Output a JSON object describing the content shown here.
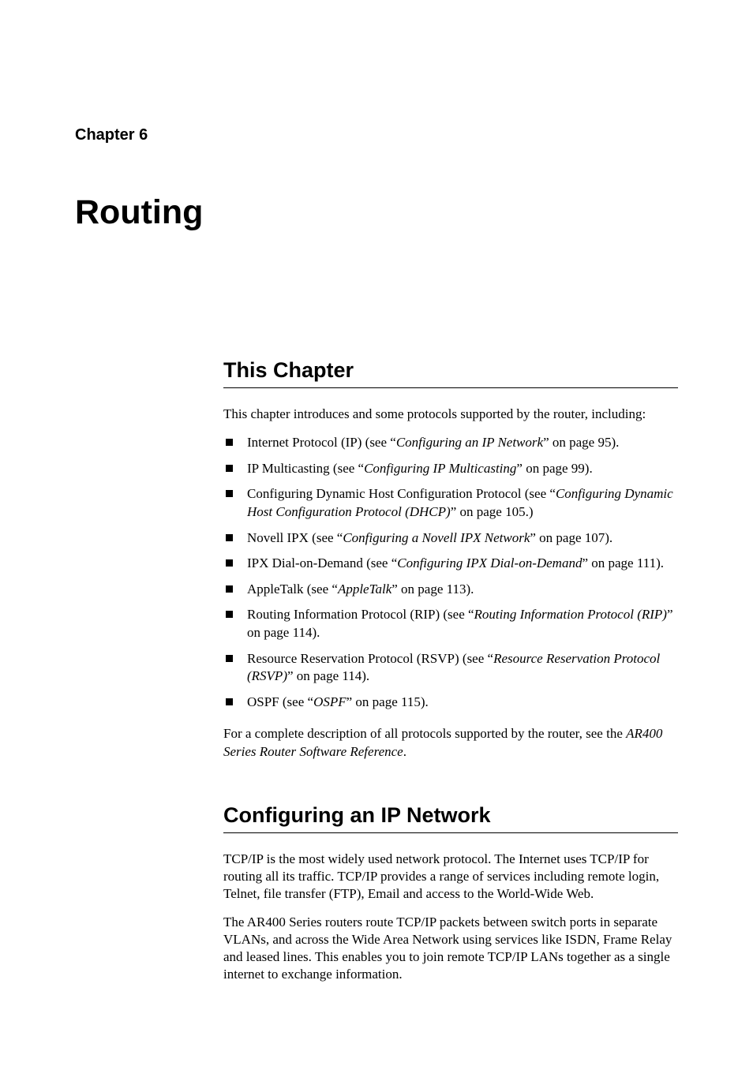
{
  "chapter_label": "Chapter 6",
  "chapter_title": "Routing",
  "section1": {
    "heading": "This Chapter",
    "intro": "This chapter introduces and some protocols supported by the router, including:",
    "items": [
      {
        "pre": "Internet Protocol (IP) (see “",
        "em": "Configuring an IP Network",
        "post": "” on page 95)."
      },
      {
        "pre": "IP Multicasting (see “",
        "em": "Configuring IP Multicasting",
        "post": "” on page 99)."
      },
      {
        "pre": "Configuring Dynamic Host Configuration Protocol (see “",
        "em": "Configuring Dynamic Host Configuration Protocol (DHCP)",
        "post": "” on page 105.)"
      },
      {
        "pre": "Novell IPX (see “",
        "em": "Configuring a Novell IPX Network",
        "post": "” on page 107)."
      },
      {
        "pre": "IPX Dial-on-Demand (see “",
        "em": "Configuring IPX Dial-on-Demand",
        "post": "” on page 111)."
      },
      {
        "pre": "AppleTalk (see “",
        "em": "AppleTalk",
        "post": "” on page 113)."
      },
      {
        "pre": "Routing Information Protocol (RIP) (see “",
        "em": "Routing Information Protocol (RIP)",
        "post": "” on page 114)."
      },
      {
        "pre": "Resource Reservation Protocol (RSVP) (see “",
        "em": "Resource Reservation Protocol (RSVP)",
        "post": "” on page 114)."
      },
      {
        "pre": "OSPF (see “",
        "em": "OSPF",
        "post": "” on page 115)."
      }
    ],
    "outro_pre": "For a complete description of all protocols supported by the router, see the ",
    "outro_em": "AR400 Series Router Software Reference",
    "outro_post": "."
  },
  "section2": {
    "heading": "Configuring an IP Network",
    "para1": "TCP/IP is the most widely used network protocol. The Internet uses TCP/IP for routing all its traffic. TCP/IP provides a range of services including remote login, Telnet, file transfer (FTP), Email and access to the World-Wide Web.",
    "para2": "The AR400 Series routers route TCP/IP packets between switch ports in separate VLANs, and across the Wide Area Network using services like ISDN, Frame Relay and leased lines. This enables you to join remote TCP/IP LANs together as a single internet to exchange information."
  }
}
